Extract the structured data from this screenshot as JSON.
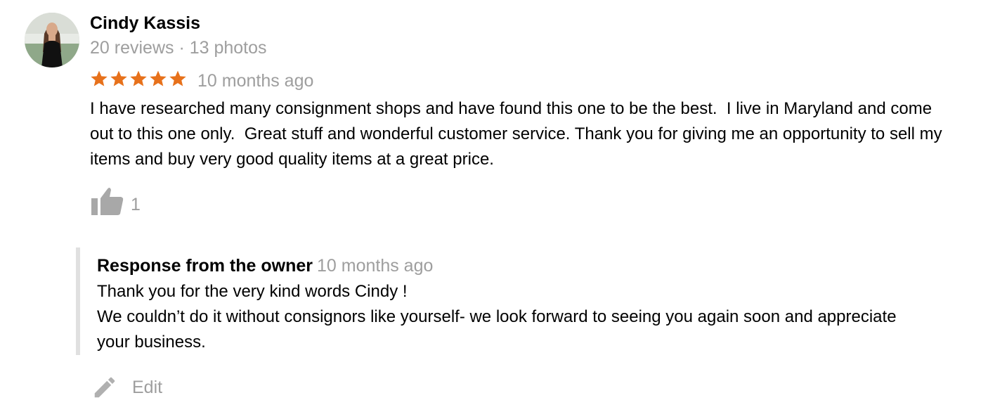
{
  "reviewer": {
    "name": "Cindy Kassis",
    "meta": "20 reviews · 13 photos"
  },
  "rating": {
    "stars": 5,
    "max": 5,
    "star_color": "#e7711b",
    "time": "10 months ago"
  },
  "review": {
    "text": "I have researched many consignment shops and have found this one to be the best.  I live in Maryland and come out to this one only.  Great stuff and wonderful customer service. Thank you for giving me an opportunity to sell my items and buy very good quality items at a great price."
  },
  "like": {
    "icon": "thumbs-up-icon",
    "count": "1"
  },
  "owner_response": {
    "label": "Response from the owner",
    "time": "10 months ago",
    "lines": [
      "Thank you for the very kind words Cindy !",
      "We couldn’t do it without consignors like yourself- we look forward to seeing you again soon and appreciate your business."
    ]
  },
  "edit": {
    "icon": "pencil-icon",
    "label": "Edit"
  },
  "colors": {
    "secondary_text": "#9e9e9e",
    "icon_gray": "#b0b0b0",
    "quote_border": "#e0e0e0"
  }
}
